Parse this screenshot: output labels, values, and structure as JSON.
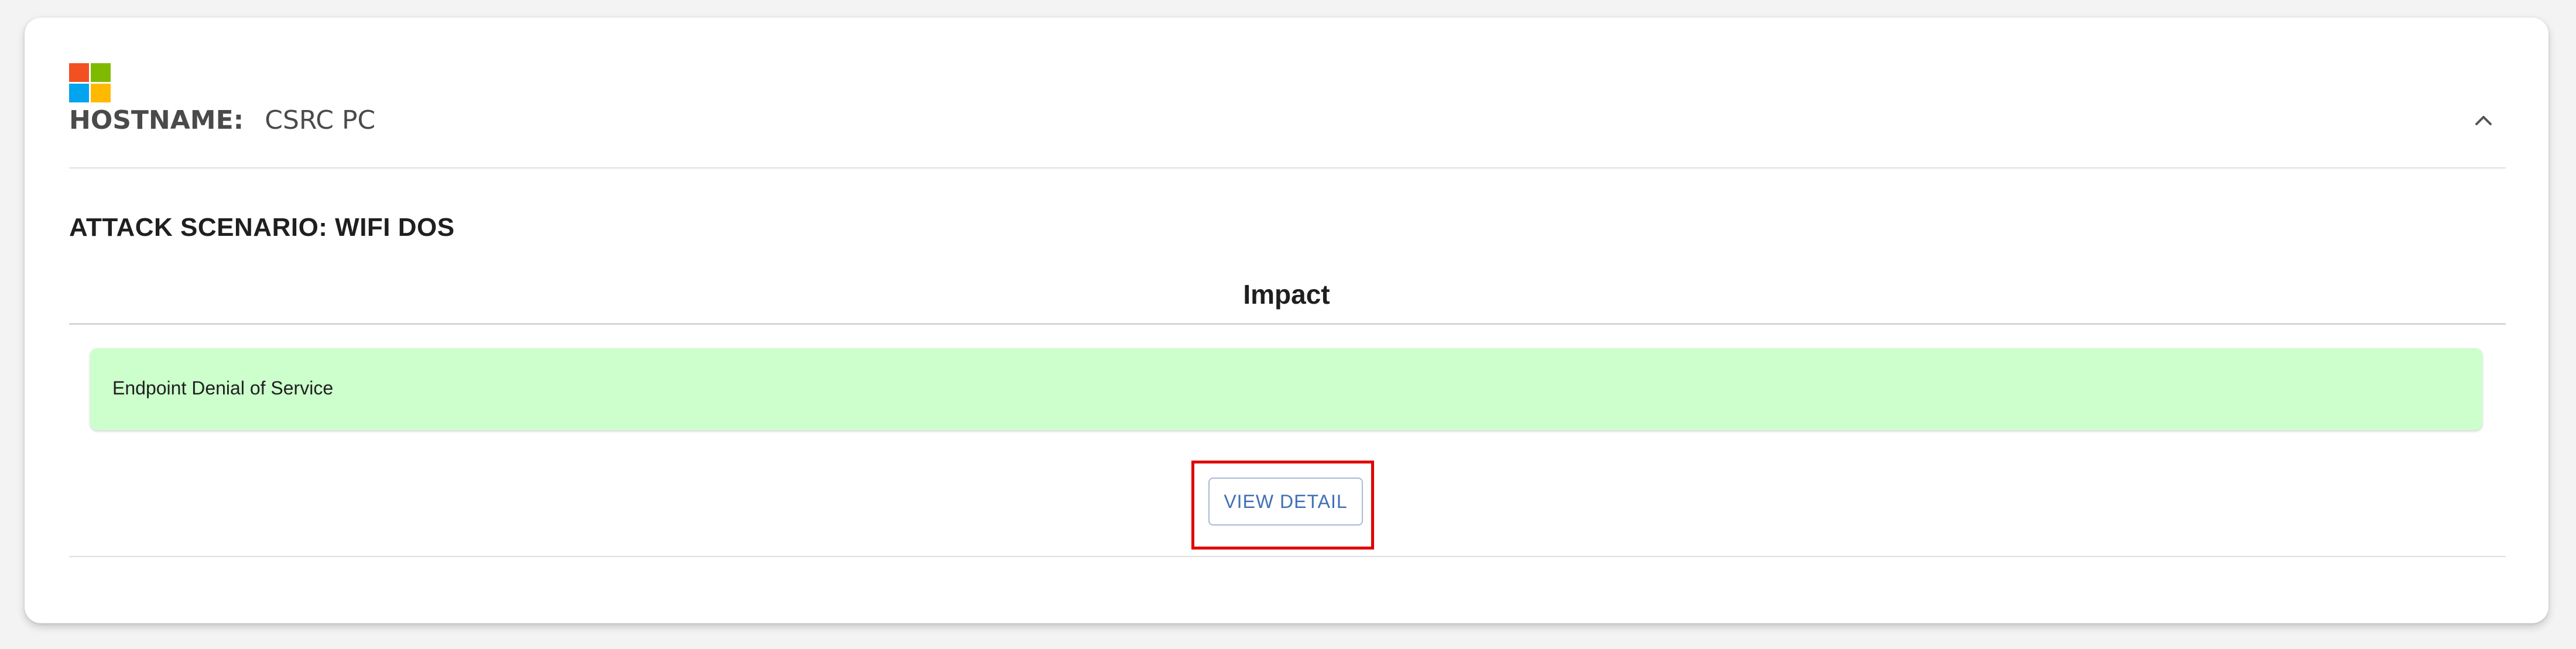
{
  "host": {
    "os_icon": "windows-logo-icon",
    "label": "HOSTNAME:",
    "value": "CSRC PC",
    "collapse_icon": "chevron-up-icon"
  },
  "scenario": {
    "title": "ATTACK SCENARIO: WIFI DOS"
  },
  "impact": {
    "heading": "Impact",
    "items": [
      "Endpoint Denial of Service"
    ],
    "box_color": "#ccffcc"
  },
  "actions": {
    "view_detail_label": "VIEW DETAIL",
    "highlight_color": "#e00000",
    "accent_color": "#3f6fb5"
  }
}
